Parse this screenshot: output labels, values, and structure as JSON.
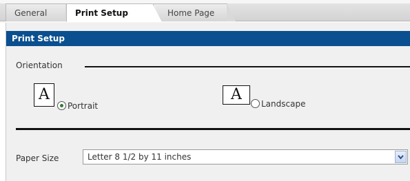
{
  "tabs": [
    {
      "label": "General"
    },
    {
      "label": "Print Setup",
      "selected": true
    },
    {
      "label": "Home Page"
    }
  ],
  "section": {
    "title": "Print Setup"
  },
  "orientation": {
    "label": "Orientation",
    "icon_glyph": "A",
    "options": [
      {
        "label": "Portrait",
        "checked": true,
        "icon": "portrait-page-icon"
      },
      {
        "label": "Landscape",
        "checked": false,
        "icon": "landscape-page-icon"
      }
    ]
  },
  "paper": {
    "label": "Paper Size",
    "selected": "Letter 8 1/2 by 11 inches",
    "icon": "chevron-down-icon"
  },
  "colors": {
    "header_bg": "#0a4f8f",
    "radio_dot": "#2e7d32"
  }
}
